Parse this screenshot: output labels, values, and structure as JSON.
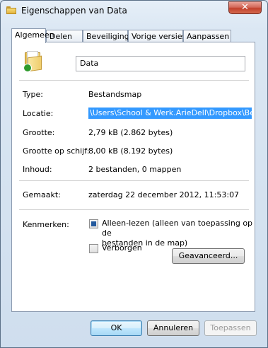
{
  "window": {
    "title": "Eigenschappen van Data",
    "close_label": "✕"
  },
  "tabs": [
    {
      "label": "Algemeen"
    },
    {
      "label": "Delen"
    },
    {
      "label": "Beveiliging"
    },
    {
      "label": "Vorige versies"
    },
    {
      "label": "Aanpassen"
    }
  ],
  "active_tab": "Algemeen",
  "general": {
    "name_value": "Data",
    "type_label": "Type:",
    "type_value": "Bestandsmap",
    "location_label": "Locatie:",
    "location_value": "\\Users\\School & Werk.ArieDell\\Dropbox\\Bedrijf",
    "size_label": "Grootte:",
    "size_value": "2,79 kB (2.862 bytes)",
    "disk_size_label": "Grootte op schijf:",
    "disk_size_value": "8,00 kB (8.192 bytes)",
    "contents_label": "Inhoud:",
    "contents_value": "2 bestanden, 0 mappen",
    "created_label": "Gemaakt:",
    "created_value": "zaterdag 22 december 2012, 11:53:07",
    "attributes_label": "Kenmerken:",
    "readonly_label_1": "Alleen-lezen (alleen van toepassing op de",
    "readonly_label_2": "bestanden in de map)",
    "readonly_state": "indeterminate",
    "hidden_label": "Verborgen",
    "hidden_checked": false,
    "advanced_button": "Geavanceerd..."
  },
  "footer": {
    "ok": "OK",
    "cancel": "Annuleren",
    "apply": "Toepassen"
  }
}
